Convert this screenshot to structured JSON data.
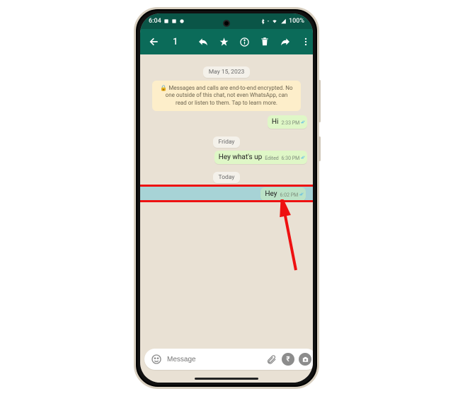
{
  "statusbar": {
    "time": "6:04",
    "battery": "100%"
  },
  "actionbar": {
    "selected_count": "1"
  },
  "chat": {
    "date1": "May 15, 2023",
    "encryption_notice": "Messages and calls are end-to-end encrypted. No one outside of this chat, not even WhatsApp, can read or listen to them. Tap to learn more.",
    "msg1": {
      "text": "Hi",
      "time": "2:33 PM"
    },
    "date2": "Friday",
    "msg2": {
      "text": "Hey what's up",
      "edited": "Edited",
      "time": "6:30 PM"
    },
    "date3": "Today",
    "msg3": {
      "text": "Hey",
      "time": "6:02 PM"
    }
  },
  "input": {
    "placeholder": "Message"
  }
}
